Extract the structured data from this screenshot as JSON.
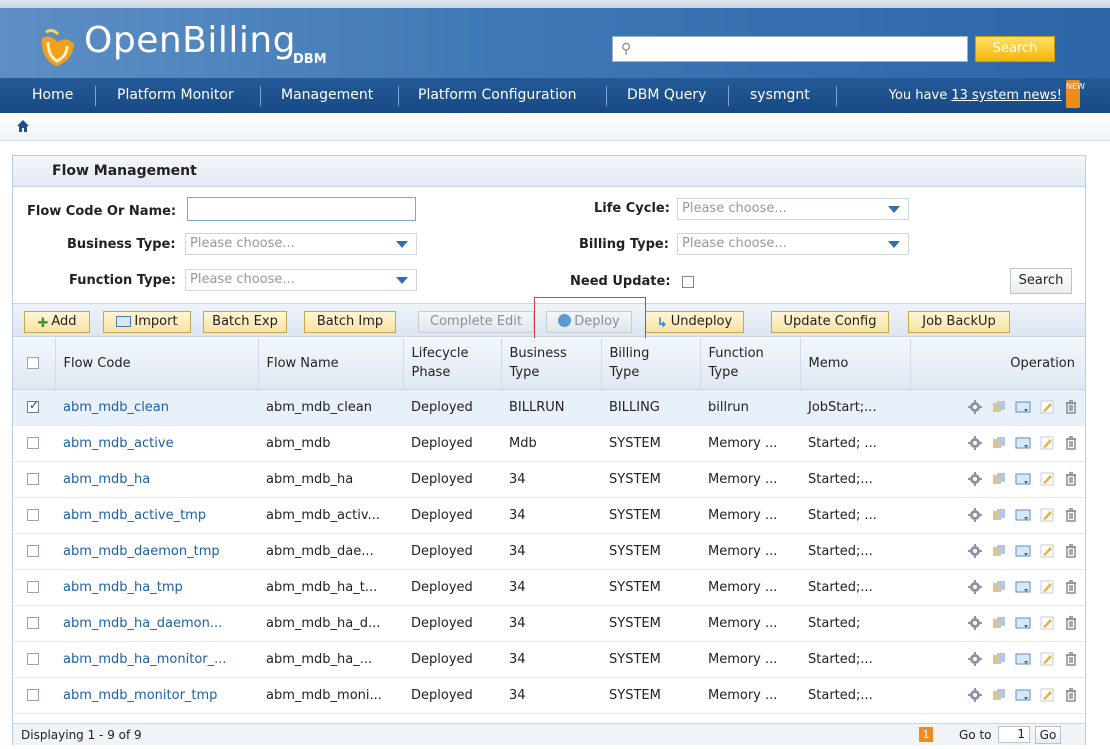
{
  "header": {
    "logo_text": "OpenBilling",
    "logo_sub": "DBM",
    "search_placeholder": "",
    "search_button": "Search"
  },
  "nav": {
    "items": [
      "Home",
      "Platform Monitor",
      "Management",
      "Platform Configuration",
      "DBM Query",
      "sysmgnt"
    ],
    "news_prefix": "You have ",
    "news_link": "13 system news!",
    "new_badge": "NEW"
  },
  "panel": {
    "title": "Flow Management"
  },
  "form": {
    "flow_code_label": "Flow Code Or Name:",
    "flow_code_value": "",
    "business_type_label": "Business Type:",
    "business_type_value": "Please choose...",
    "function_type_label": "Function Type:",
    "function_type_value": "Please choose...",
    "life_cycle_label": "Life Cycle:",
    "life_cycle_value": "Please choose...",
    "billing_type_label": "Billing Type:",
    "billing_type_value": "Please choose...",
    "need_update_label": "Need Update:",
    "search_button": "Search"
  },
  "toolbar": {
    "add": "Add",
    "import": "Import",
    "batch_exp": "Batch Exp",
    "batch_imp": "Batch Imp",
    "complete_edit": "Complete Edit",
    "deploy": "Deploy",
    "undeploy": "Undeploy",
    "update_config": "Update Config",
    "job_backup": "Job BackUp"
  },
  "table": {
    "headers": {
      "flow_code": "Flow Code",
      "flow_name": "Flow Name",
      "lifecycle_1": "Lifecycle",
      "lifecycle_2": "Phase",
      "business_1": "Business",
      "business_2": "Type",
      "billing_1": "Billing",
      "billing_2": "Type",
      "function_1": "Function",
      "function_2": "Type",
      "memo": "Memo",
      "operation": "Operation"
    },
    "rows": [
      {
        "code": "abm_mdb_clean",
        "name": "abm_mdb_clean",
        "phase": "Deployed",
        "business": "BILLRUN",
        "billing": "BILLING",
        "function": "billrun",
        "memo": "JobStart;..."
      },
      {
        "code": "abm_mdb_active",
        "name": "abm_mdb",
        "phase": "Deployed",
        "business": "Mdb",
        "billing": "SYSTEM",
        "function": "Memory ...",
        "memo": "Started; ..."
      },
      {
        "code": "abm_mdb_ha",
        "name": "abm_mdb_ha",
        "phase": "Deployed",
        "business": "34",
        "billing": "SYSTEM",
        "function": "Memory ...",
        "memo": "Started;..."
      },
      {
        "code": "abm_mdb_active_tmp",
        "name": "abm_mdb_activ...",
        "phase": "Deployed",
        "business": "34",
        "billing": "SYSTEM",
        "function": "Memory ...",
        "memo": "Started; ..."
      },
      {
        "code": "abm_mdb_daemon_tmp",
        "name": "abm_mdb_dae...",
        "phase": "Deployed",
        "business": "34",
        "billing": "SYSTEM",
        "function": "Memory ...",
        "memo": "Started;..."
      },
      {
        "code": "abm_mdb_ha_tmp",
        "name": "abm_mdb_ha_t...",
        "phase": "Deployed",
        "business": "34",
        "billing": "SYSTEM",
        "function": "Memory ...",
        "memo": "Started;..."
      },
      {
        "code": "abm_mdb_ha_daemon...",
        "name": "abm_mdb_ha_d...",
        "phase": "Deployed",
        "business": "34",
        "billing": "SYSTEM",
        "function": "Memory ...",
        "memo": "Started;"
      },
      {
        "code": "abm_mdb_ha_monitor_...",
        "name": "abm_mdb_ha_...",
        "phase": "Deployed",
        "business": "34",
        "billing": "SYSTEM",
        "function": "Memory ...",
        "memo": "Started;..."
      },
      {
        "code": "abm_mdb_monitor_tmp",
        "name": "abm_mdb_moni...",
        "phase": "Deployed",
        "business": "34",
        "billing": "SYSTEM",
        "function": "Memory ...",
        "memo": "Started;..."
      }
    ],
    "selected_row": 0
  },
  "pager": {
    "display": "Displaying 1 - 9 of 9",
    "current_page": "1",
    "goto_label": "Go to",
    "goto_value": "1",
    "go_button": "Go"
  },
  "colors": {
    "header_blue": "#3f78b6",
    "nav_blue": "#1d528f",
    "accent_orange": "#f08a1a",
    "link_blue": "#1f5fa6",
    "highlight_red": "#d9403a"
  }
}
